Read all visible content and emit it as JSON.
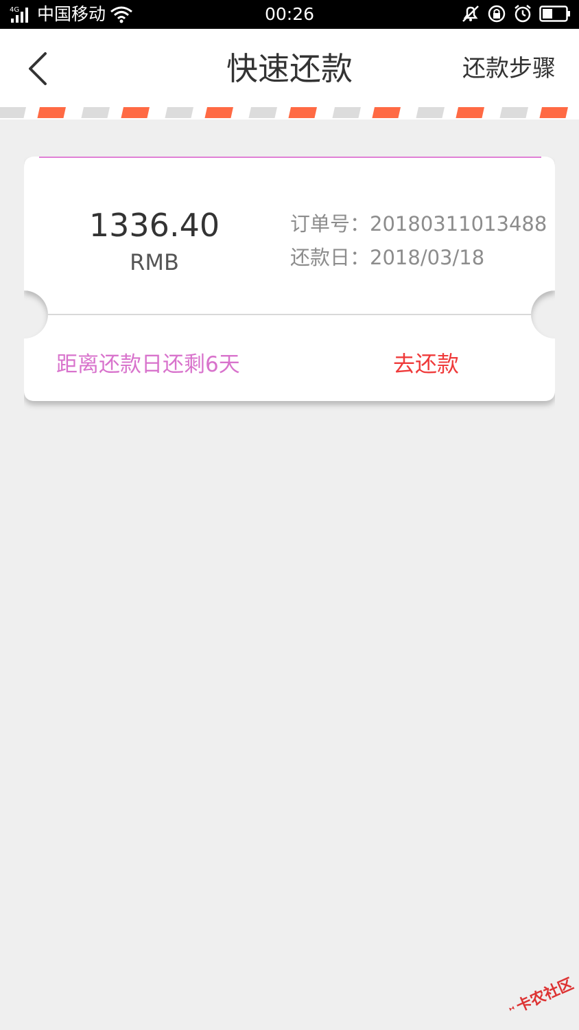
{
  "status_bar": {
    "network": "4G",
    "carrier": "中国移动",
    "time": "00:26"
  },
  "navbar": {
    "title": "快速还款",
    "steps_label": "还款步骤"
  },
  "ticket": {
    "amount": "1336.40",
    "currency": "RMB",
    "order_label": "订单号：",
    "order_number": "20180311013488",
    "due_label": "还款日：",
    "due_date": "2018/03/18",
    "countdown": "距离还款日还剩6天",
    "pay_label": "去还款"
  },
  "watermark": {
    "text": "卡农社区"
  },
  "colors": {
    "page_bg": "#efefef",
    "stripe_accent": "#ff6a44",
    "stripe_gray": "#dcdcdc",
    "ticket_top_line": "#e07fd6",
    "countdown_text": "#d873cc",
    "pay_text": "#ef3a3a"
  }
}
